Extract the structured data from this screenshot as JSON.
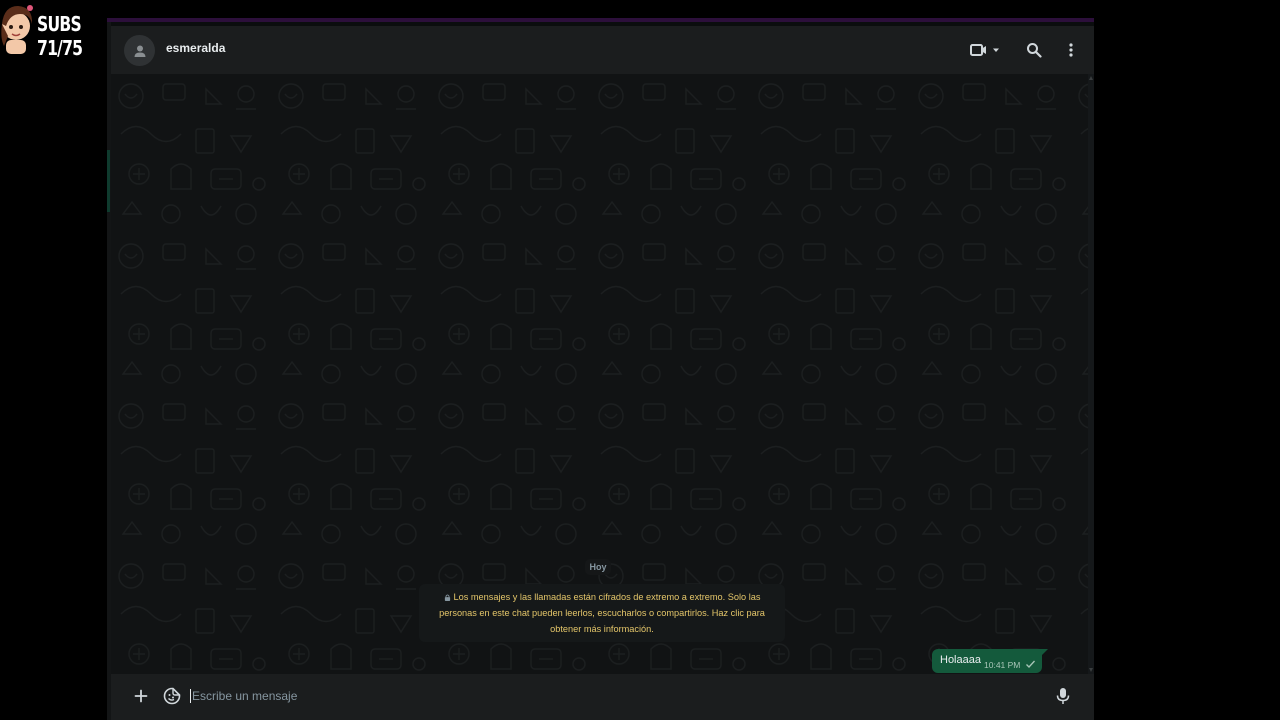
{
  "overlay": {
    "subs_text": "SUBS 71/75"
  },
  "header": {
    "contact_name": "esmeralda",
    "icons": {
      "avatar": "person-icon",
      "video": "video-call-icon",
      "search": "search-icon",
      "menu": "kebab-menu-icon"
    }
  },
  "chat": {
    "date_chip": "Hoy",
    "encryption_notice": {
      "icon": "lock-icon",
      "line1": "Los mensajes y las llamadas están cifrados de extremo a extremo. Solo las",
      "line2": "personas en este chat pueden leerlos, escucharlos o compartirlos. Haz clic para",
      "line3": "obtener más información."
    },
    "messages": [
      {
        "text": "Holaaaa",
        "time": "10:41 PM",
        "status": "sent-check-icon"
      }
    ]
  },
  "composer": {
    "placeholder": "Escribe un mensaje",
    "value": "",
    "icons": {
      "attach": "plus-icon",
      "sticker": "sticker-icon",
      "mic": "microphone-icon"
    }
  },
  "colors": {
    "header_bg": "#1b1d1e",
    "chat_bg": "#111314",
    "outgoing_bubble": "#145a3c",
    "notice_text": "#e4c66a",
    "secondary_text": "#8696a0",
    "accent_strip": "#2c0f3b"
  }
}
